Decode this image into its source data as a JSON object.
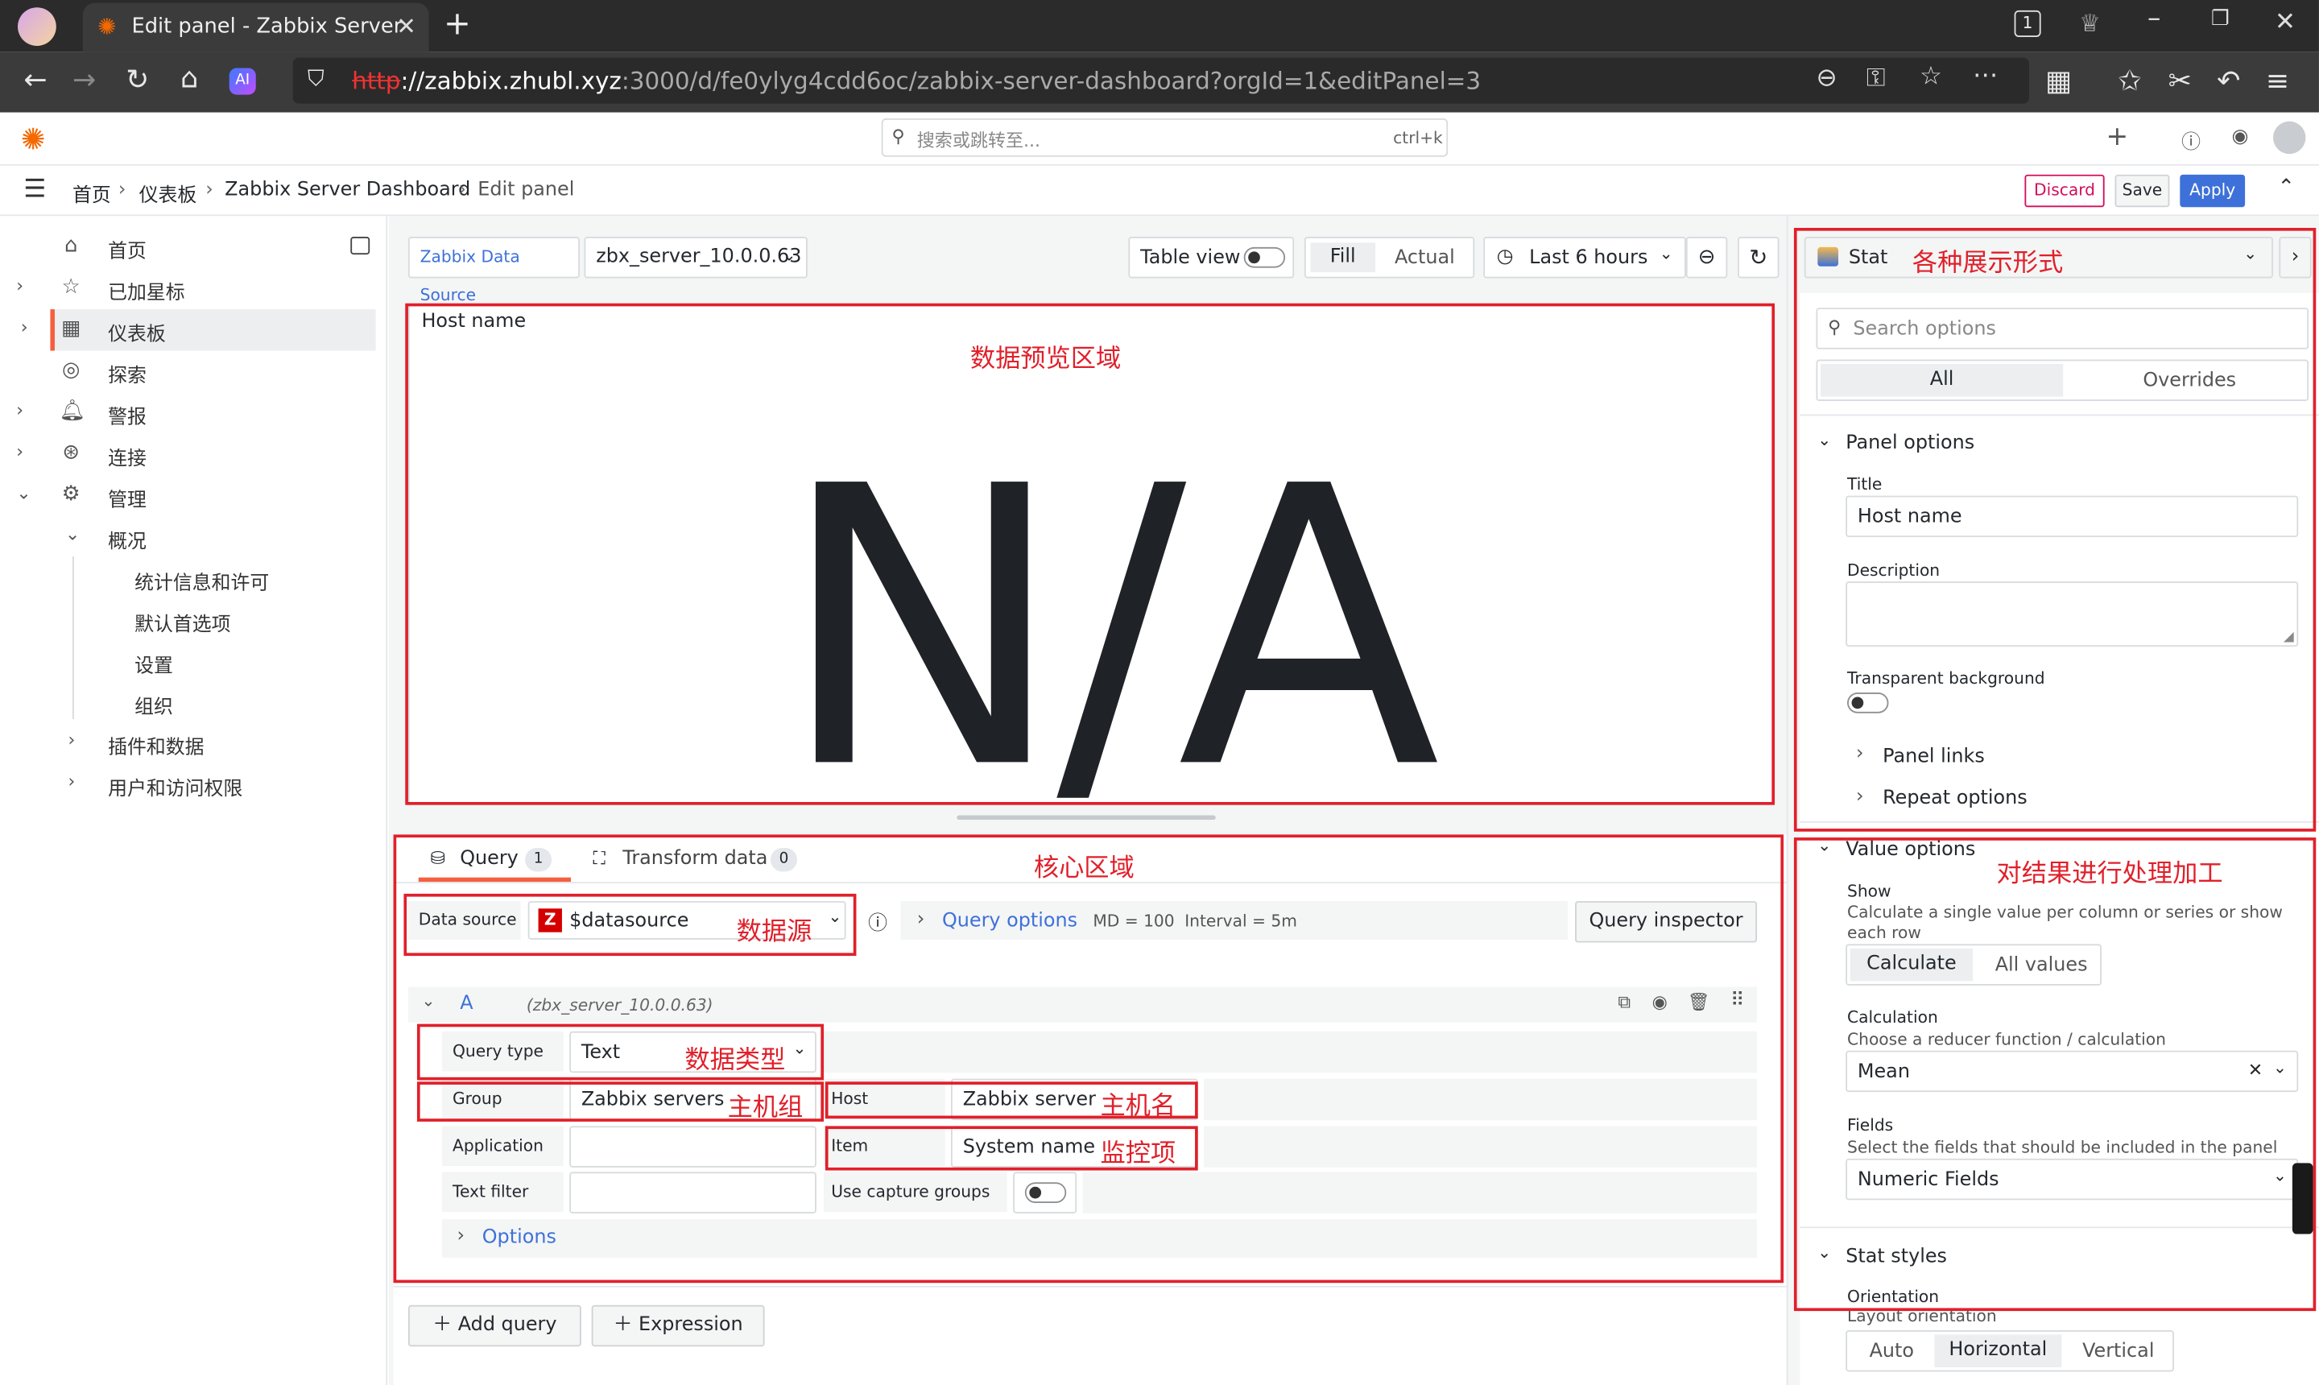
{
  "browser": {
    "tab_title": "Edit panel - Zabbix Server",
    "tab_count": "1",
    "url_scheme": "http",
    "url_host": "://zabbix.zhubl.xyz",
    "url_rest": ":3000/d/fe0ylyg4cdd6oc/zabbix-server-dashboard?orgId=1&editPanel=3"
  },
  "topbar": {
    "search_placeholder": "搜索或跳转至...",
    "shortcut": "ctrl+k",
    "plus": "+"
  },
  "breadcrumb": {
    "home": "首页",
    "dashboards": "仪表板",
    "dashboard": "Zabbix Server Dashboard",
    "current": "Edit panel"
  },
  "actions": {
    "discard": "Discard",
    "save": "Save",
    "apply": "Apply"
  },
  "sidebar": {
    "items": [
      {
        "label": "首页",
        "icon": "home-icon"
      },
      {
        "label": "已加星标",
        "icon": "star-icon"
      },
      {
        "label": "仪表板",
        "icon": "grid-icon"
      },
      {
        "label": "探索",
        "icon": "compass-icon"
      },
      {
        "label": "警报",
        "icon": "bell-icon"
      },
      {
        "label": "连接",
        "icon": "link-icon"
      },
      {
        "label": "管理",
        "icon": "gear-icon"
      }
    ],
    "sub": [
      "概况",
      "统计信息和许可",
      "默认首选项",
      "设置",
      "组织",
      "插件和数据",
      "用户和访问权限"
    ]
  },
  "panel_toolbar": {
    "ds_label": "Zabbix Data Source",
    "ds_value": "zbx_server_10.0.0.63",
    "table_view": "Table view",
    "fill": "Fill",
    "actual": "Actual",
    "time_range": "Last 6 hours"
  },
  "preview": {
    "title": "Host name",
    "value": "N/A"
  },
  "query_tabs": {
    "query": "Query",
    "query_count": "1",
    "transform": "Transform data",
    "transform_count": "0"
  },
  "query_bar": {
    "ds_label": "Data source",
    "ds_value": "$datasource",
    "options": "Query options",
    "md": "MD = 100",
    "interval": "Interval = 5m",
    "inspector": "Query inspector"
  },
  "query_a": {
    "ref": "A",
    "source": "(zbx_server_10.0.0.63)",
    "query_type_label": "Query type",
    "query_type": "Text",
    "group_label": "Group",
    "group": "Zabbix servers",
    "host_label": "Host",
    "host": "Zabbix server",
    "application_label": "Application",
    "application": "",
    "item_label": "Item",
    "item": "System name",
    "text_filter_label": "Text filter",
    "text_filter": "",
    "capture_label": "Use capture groups",
    "options": "Options"
  },
  "add": {
    "query": "Add query",
    "expression": "Expression"
  },
  "right": {
    "viz": "Stat",
    "search_placeholder": "Search options",
    "tab_all": "All",
    "tab_overrides": "Overrides",
    "panel_options": "Panel options",
    "title_label": "Title",
    "title_value": "Host name",
    "description_label": "Description",
    "transparent_label": "Transparent background",
    "panel_links": "Panel links",
    "repeat_options": "Repeat options",
    "value_options": "Value options",
    "show_label": "Show",
    "show_desc": "Calculate a single value per column or series or show each row",
    "calculate": "Calculate",
    "all_values": "All values",
    "calculation_label": "Calculation",
    "calculation_desc": "Choose a reducer function / calculation",
    "calculation_value": "Mean",
    "fields_label": "Fields",
    "fields_desc": "Select the fields that should be included in the panel",
    "fields_value": "Numeric Fields",
    "stat_styles": "Stat styles",
    "orientation_label": "Orientation",
    "orientation_desc": "Layout orientation",
    "orient_auto": "Auto",
    "orient_horizontal": "Horizontal",
    "orient_vertical": "Vertical"
  },
  "annotations": {
    "viz": "各种展示形式",
    "preview": "数据预览区域",
    "core": "核心区域",
    "process": "对结果进行处理加工",
    "datasource": "数据源",
    "datatype": "数据类型",
    "group": "主机组",
    "host": "主机名",
    "item": "监控项"
  },
  "colors": {
    "accent": "#3d71d9",
    "annotation": "#e0202a",
    "discard": "#d10e5c",
    "query_tab": "#f55f3e"
  }
}
